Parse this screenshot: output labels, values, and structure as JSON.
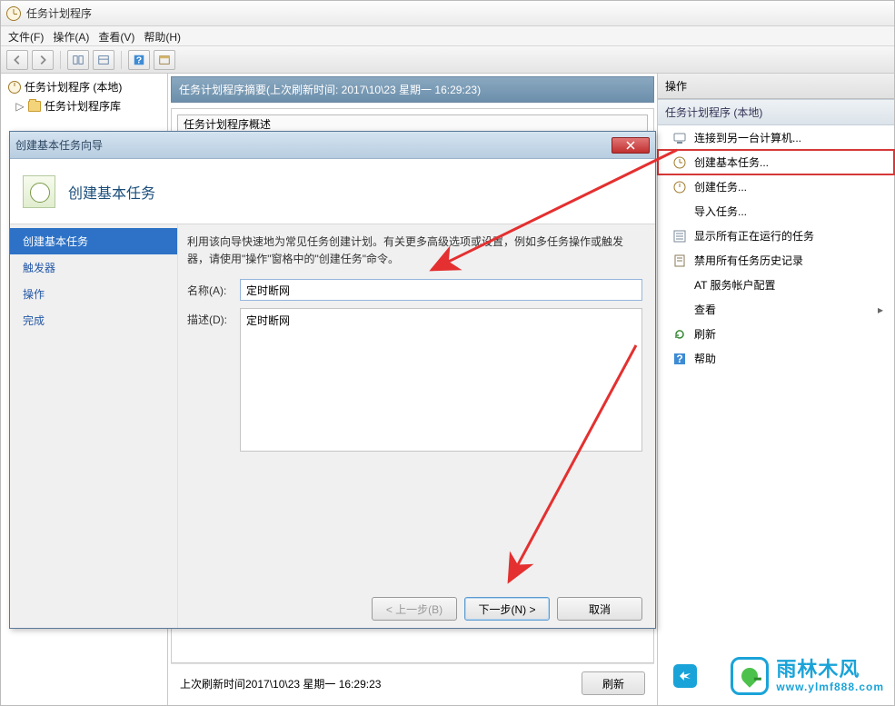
{
  "window": {
    "title": "任务计划程序"
  },
  "menubar": {
    "file": "文件(F)",
    "action": "操作(A)",
    "view": "查看(V)",
    "help": "帮助(H)"
  },
  "tree": {
    "root": "任务计划程序 (本地)",
    "library": "任务计划程序库"
  },
  "summary": "任务计划程序摘要(上次刷新时间: 2017\\10\\23 星期一 16:29:23)",
  "inner_task_header": "任务计划程序概述",
  "refresh_line": "上次刷新时间2017\\10\\23 星期一 16:29:23",
  "refresh_btn": "刷新",
  "actions": {
    "header": "操作",
    "section": "任务计划程序 (本地)",
    "items": [
      "连接到另一台计算机...",
      "创建基本任务...",
      "创建任务...",
      "导入任务...",
      "显示所有正在运行的任务",
      "禁用所有任务历史记录",
      "AT 服务帐户配置",
      "查看",
      "刷新",
      "帮助"
    ]
  },
  "wizard": {
    "titlebar": "创建基本任务向导",
    "header": "创建基本任务",
    "nav": {
      "step1": "创建基本任务",
      "step2": "触发器",
      "step3": "操作",
      "step4": "完成"
    },
    "hint": "利用该向导快速地为常见任务创建计划。有关更多高级选项或设置，例如多任务操作或触发器，请使用\"操作\"窗格中的\"创建任务\"命令。",
    "name_label": "名称(A):",
    "name_value": "定时断网",
    "desc_label": "描述(D):",
    "desc_value": "定时断网",
    "btn_prev": "< 上一步(B)",
    "btn_next": "下一步(N) >",
    "btn_cancel": "取消"
  },
  "watermark": {
    "brand": "雨林木风",
    "url": "www.ylmf888.com"
  }
}
